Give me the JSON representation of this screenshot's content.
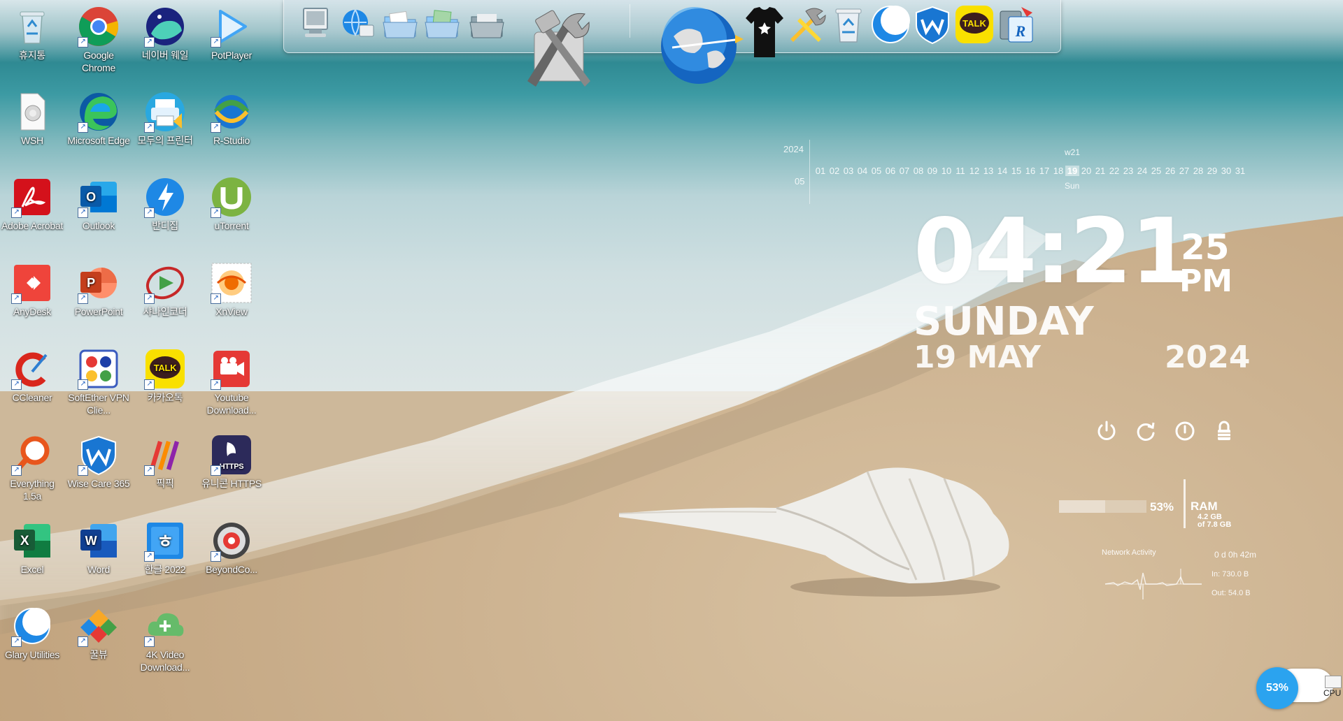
{
  "desktop": {
    "icons": [
      {
        "label": "휴지통"
      },
      {
        "label": "Google Chrome"
      },
      {
        "label": "네이버 웨일"
      },
      {
        "label": "PotPlayer"
      },
      {
        "label": "WSH"
      },
      {
        "label": "Microsoft Edge"
      },
      {
        "label": "모두의 프린터"
      },
      {
        "label": "R-Studio"
      },
      {
        "label": "Adobe Acrobat"
      },
      {
        "label": "Outlook"
      },
      {
        "label": "반디집"
      },
      {
        "label": "uTorrent"
      },
      {
        "label": "AnyDesk"
      },
      {
        "label": "PowerPoint"
      },
      {
        "label": "샤나인코더"
      },
      {
        "label": "XnView"
      },
      {
        "label": "CCleaner"
      },
      {
        "label": "SoftEther VPN Clie..."
      },
      {
        "label": "카카오톡"
      },
      {
        "label": "Youtube Download..."
      },
      {
        "label": "Everything 1.5a"
      },
      {
        "label": "Wise Care 365"
      },
      {
        "label": "픽픽"
      },
      {
        "label": "유니콘 HTTPS"
      },
      {
        "label": "Excel"
      },
      {
        "label": "Word"
      },
      {
        "label": "한글 2022"
      },
      {
        "label": "BeyondCo..."
      },
      {
        "label": "Glary Utilities"
      },
      {
        "label": "꿀뷰"
      },
      {
        "label": "4K Video Download..."
      }
    ]
  },
  "dock": {
    "talk_label": "TALK"
  },
  "calendar": {
    "year": "2024",
    "month": "05",
    "week": "w21",
    "days": [
      "01",
      "02",
      "03",
      "04",
      "05",
      "06",
      "07",
      "08",
      "09",
      "10",
      "11",
      "12",
      "13",
      "14",
      "15",
      "16",
      "17",
      "18",
      "19",
      "20",
      "21",
      "22",
      "23",
      "24",
      "25",
      "26",
      "27",
      "28",
      "29",
      "30",
      "31"
    ],
    "today_index": 18,
    "today_name": "Sun"
  },
  "clock": {
    "hours_minutes": "04:21",
    "seconds": "25",
    "ampm": "PM",
    "weekday": "SUNDAY",
    "date": "19 MAY",
    "year": "2024"
  },
  "ram": {
    "percent_text": "53%",
    "fill": 0.53,
    "label": "RAM",
    "used": "4.2 GB",
    "total": "of 7.8 GB"
  },
  "network": {
    "title": "Network Activity",
    "uptime": "0 d 0h 42m",
    "in": "In: 730.0 B",
    "out": "Out: 54.0 B"
  },
  "cpu": {
    "percent_text": "53%",
    "label": "CPU"
  },
  "colors": {
    "cpu_accent": "#2ba3ef",
    "talk_yellow": "#f9e000"
  }
}
